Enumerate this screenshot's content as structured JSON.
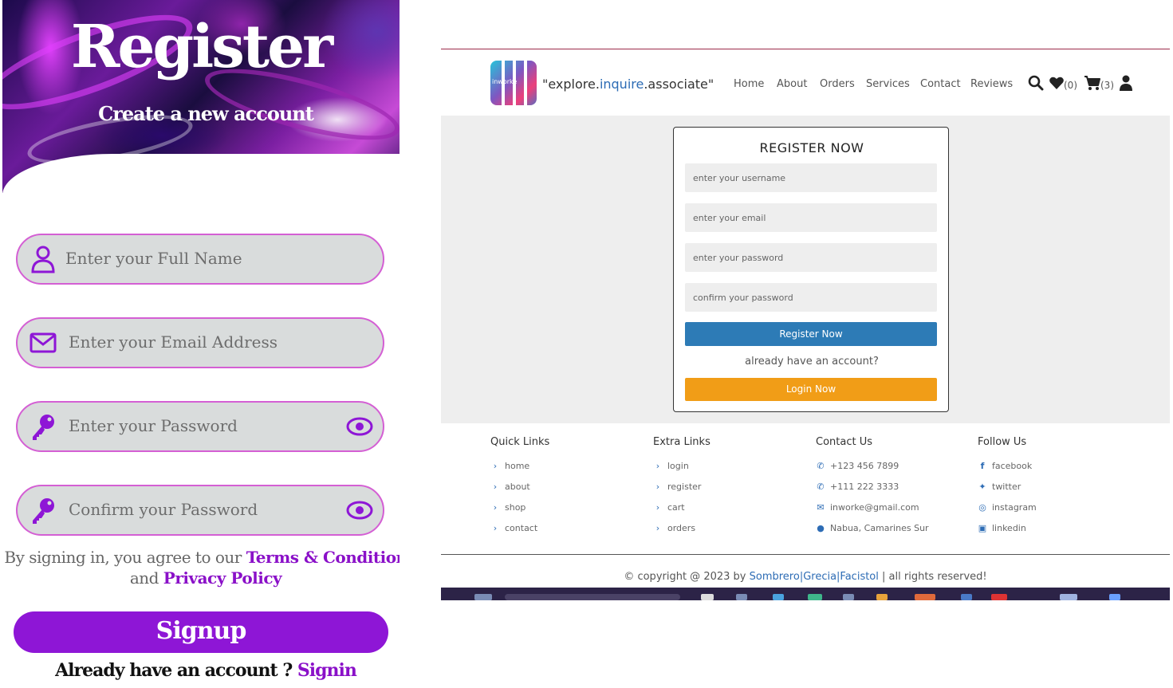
{
  "mobile": {
    "title": "Register",
    "subtitle": "Create a new account",
    "fields": [
      {
        "placeholder": "Enter your Full Name",
        "icon": "user-icon"
      },
      {
        "placeholder": "Enter your Email Address",
        "icon": "envelope-icon"
      },
      {
        "placeholder": "Enter your Password",
        "icon": "key-icon",
        "toggle": "eye-icon"
      },
      {
        "placeholder": "Confirm your Password",
        "icon": "key-icon",
        "toggle": "eye-icon"
      }
    ],
    "terms_prefix": "By signing in, you agree to our",
    "terms_link": "Terms & Condition",
    "terms_and": "and",
    "privacy_link": "Privacy Policy",
    "signup_label": "Signup",
    "already_text": "Already have an account ?",
    "signin_link": "Signin",
    "accent_color": "#8e16d6"
  },
  "web": {
    "slogan_prefix": "\"explore.",
    "slogan_accent": "inquire",
    "slogan_suffix": ".associate\"",
    "logo_text": "inworke",
    "nav": [
      "Home",
      "About",
      "Orders",
      "Services",
      "Contact",
      "Reviews"
    ],
    "wishlist_count": "(0)",
    "cart_count": "(3)",
    "form": {
      "heading": "REGISTER NOW",
      "username_placeholder": "enter your username",
      "email_placeholder": "enter your email",
      "password_placeholder": "enter your password",
      "confirm_placeholder": "confirm your password",
      "register_label": "Register Now",
      "already_text": "already have an account?",
      "login_label": "Login Now"
    },
    "footer": {
      "quick": {
        "title": "Quick Links",
        "items": [
          "home",
          "about",
          "shop",
          "contact"
        ]
      },
      "extra": {
        "title": "Extra Links",
        "items": [
          "login",
          "register",
          "cart",
          "orders"
        ]
      },
      "contact": {
        "title": "Contact Us",
        "items": [
          "+123 456 7899",
          "+111 222 3333",
          "inworke@gmail.com",
          "Nabua, Camarines Sur"
        ]
      },
      "follow": {
        "title": "Follow Us",
        "items": [
          "facebook",
          "twitter",
          "instagram",
          "linkedin"
        ]
      }
    },
    "copyright_prefix": "© copyright @ 2023 by",
    "copyright_authors": "Sombrero|Grecia|Facistol",
    "copyright_suffix": "| all rights reserved!",
    "colors": {
      "primary": "#2d7bb6",
      "orange": "#f19d17",
      "link": "#2d6cb5"
    }
  }
}
